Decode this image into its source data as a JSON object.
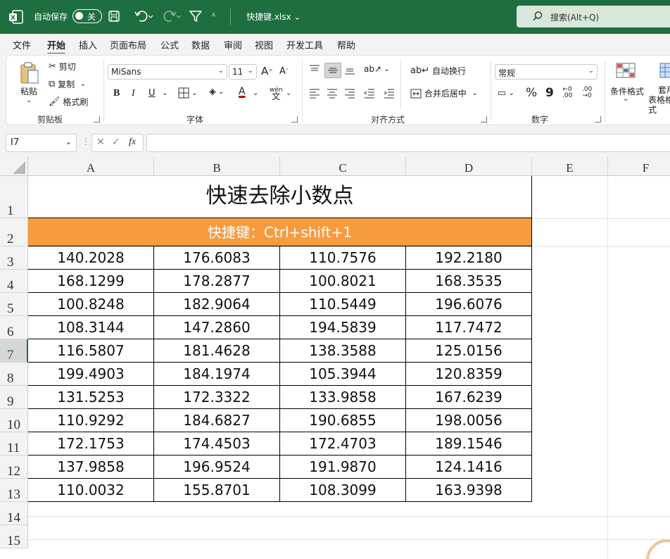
{
  "titlebar": {
    "autosave_label": "自动保存",
    "autosave_state": "关",
    "qat_more": "⩡",
    "document_title": "快捷键.xlsx ⌄",
    "search_placeholder": "搜索(Alt+Q)"
  },
  "menu_tabs": [
    "文件",
    "开始",
    "插入",
    "页面布局",
    "公式",
    "数据",
    "审阅",
    "视图",
    "开发工具",
    "帮助"
  ],
  "ribbon": {
    "clipboard": {
      "paste": "粘贴",
      "cut": "剪切",
      "copy": "复制",
      "format_painter": "格式刷",
      "label": "剪贴板"
    },
    "font": {
      "name": "MiSans",
      "size": "11",
      "bold": "B",
      "italic": "I",
      "underline": "U",
      "label": "字体"
    },
    "alignment": {
      "wrap_text": "自动换行",
      "merge_center": "合并后居中",
      "label": "对齐方式"
    },
    "number": {
      "format": "常规",
      "percent": "%",
      "comma": "9",
      "label": "数字"
    },
    "styles": {
      "conditional_formatting": "条件格式",
      "table_format": "套用表格格式"
    }
  },
  "formula_bar": {
    "name_box": "I7",
    "fx": "fx",
    "content": ""
  },
  "columns": [
    "A",
    "B",
    "C",
    "D",
    "E",
    "F"
  ],
  "rows": [
    "1",
    "2",
    "3",
    "4",
    "5",
    "6",
    "7",
    "8",
    "9",
    "10",
    "11",
    "12",
    "13",
    "14",
    "15"
  ],
  "selected_row": "7",
  "sheet": {
    "title": "快速去除小数点",
    "subtitle": "快捷键：Ctrl+shift+1",
    "data": [
      [
        "140.2028",
        "176.6083",
        "110.7576",
        "192.2180"
      ],
      [
        "168.1299",
        "178.2877",
        "100.8021",
        "168.3535"
      ],
      [
        "100.8248",
        "182.9064",
        "110.5449",
        "196.6076"
      ],
      [
        "108.3144",
        "147.2860",
        "194.5839",
        "117.7472"
      ],
      [
        "116.5807",
        "181.4628",
        "138.3588",
        "125.0156"
      ],
      [
        "199.4903",
        "184.1974",
        "105.3944",
        "120.8359"
      ],
      [
        "131.5253",
        "172.3322",
        "133.9858",
        "167.6239"
      ],
      [
        "110.9292",
        "184.6827",
        "190.6855",
        "198.0056"
      ],
      [
        "172.1753",
        "174.4503",
        "172.4703",
        "189.1546"
      ],
      [
        "137.9858",
        "196.9524",
        "191.9870",
        "124.1416"
      ],
      [
        "110.0032",
        "155.8701",
        "108.3099",
        "163.9398"
      ]
    ]
  },
  "colors": {
    "brand": "#1e6e40",
    "header_fill": "#f89b3f"
  }
}
